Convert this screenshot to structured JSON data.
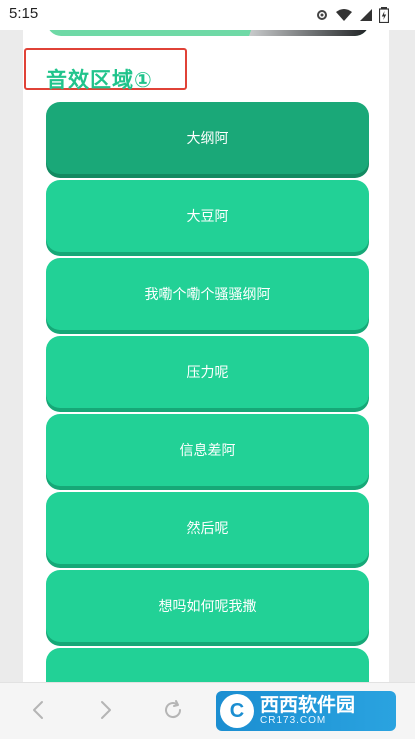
{
  "status_bar": {
    "time": "5:15"
  },
  "section": {
    "title": "音效区域①"
  },
  "sounds": [
    {
      "label": "大纲阿",
      "active": true
    },
    {
      "label": "大豆阿"
    },
    {
      "label": "我嘞个嘞个骚骚纲阿"
    },
    {
      "label": "压力呢"
    },
    {
      "label": "信息差阿"
    },
    {
      "label": "然后呢"
    },
    {
      "label": "想吗如何呢我撒"
    },
    {
      "label": ""
    }
  ],
  "watermark": {
    "badge": "C",
    "name": "西西软件园",
    "domain": "CR173.COM"
  },
  "colors": {
    "accent": "#22d196",
    "accent_dark": "#1aa878",
    "highlight": "#e04237"
  }
}
